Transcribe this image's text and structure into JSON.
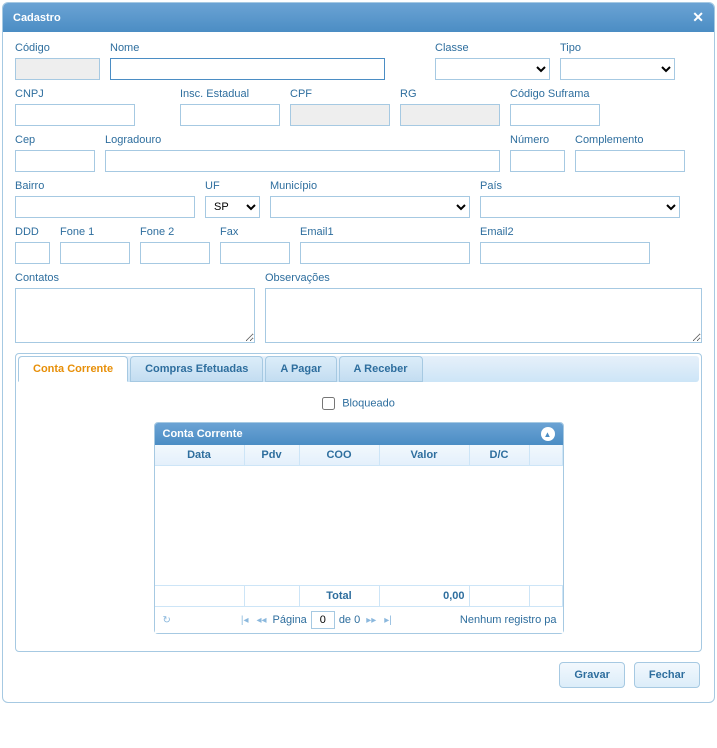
{
  "dialog": {
    "title": "Cadastro"
  },
  "labels": {
    "codigo": "Código",
    "nome": "Nome",
    "classe": "Classe",
    "tipo": "Tipo",
    "cnpj": "CNPJ",
    "insc_estadual": "Insc. Estadual",
    "cpf": "CPF",
    "rg": "RG",
    "codigo_suframa": "Código Suframa",
    "cep": "Cep",
    "logradouro": "Logradouro",
    "numero": "Número",
    "complemento": "Complemento",
    "bairro": "Bairro",
    "uf": "UF",
    "municipio": "Município",
    "pais": "País",
    "ddd": "DDD",
    "fone1": "Fone 1",
    "fone2": "Fone 2",
    "fax": "Fax",
    "email1": "Email1",
    "email2": "Email2",
    "contatos": "Contatos",
    "observacoes": "Observações",
    "bloqueado": "Bloqueado"
  },
  "values": {
    "codigo": "",
    "nome": "",
    "classe": "",
    "tipo": "",
    "cnpj": "",
    "insc_estadual": "",
    "cpf": "",
    "rg": "",
    "codigo_suframa": "",
    "cep": "",
    "logradouro": "",
    "numero": "",
    "complemento": "",
    "bairro": "",
    "uf": "SP",
    "municipio": "",
    "pais": "",
    "ddd": "",
    "fone1": "",
    "fone2": "",
    "fax": "",
    "email1": "",
    "email2": "",
    "contatos": "",
    "observacoes": ""
  },
  "tabs": [
    {
      "label": "Conta Corrente",
      "active": true
    },
    {
      "label": "Compras Efetuadas",
      "active": false
    },
    {
      "label": "A Pagar",
      "active": false
    },
    {
      "label": "A Receber",
      "active": false
    }
  ],
  "grid": {
    "title": "Conta Corrente",
    "headers": {
      "data": "Data",
      "pdv": "Pdv",
      "coo": "COO",
      "valor": "Valor",
      "dc": "D/C"
    },
    "footer": {
      "total_label": "Total",
      "total_value": "0,00"
    },
    "pager": {
      "page_label_pre": "Página",
      "page_value": "0",
      "page_label_post": "de 0",
      "status": "Nenhum registro pa"
    }
  },
  "buttons": {
    "gravar": "Gravar",
    "fechar": "Fechar"
  }
}
